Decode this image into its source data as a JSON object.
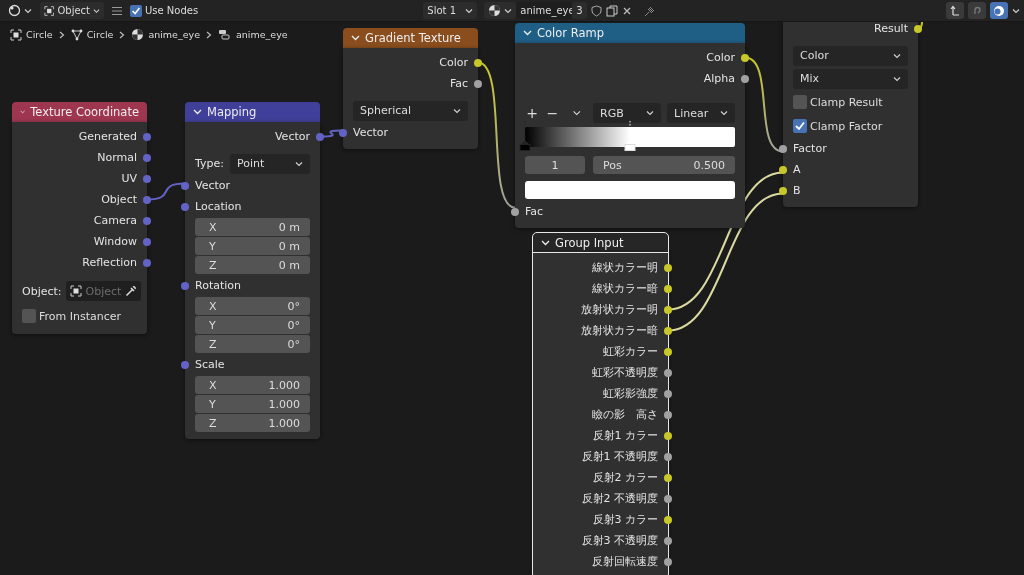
{
  "header": {
    "mode": "Object",
    "use_nodes": {
      "label": "Use Nodes",
      "checked": true
    },
    "slot": "Slot 1",
    "material": "anime_eye",
    "users": "3",
    "tools": [
      {
        "kind": "parent",
        "on": false
      },
      {
        "kind": "snap",
        "on": false
      },
      {
        "kind": "overlay",
        "on": true
      }
    ]
  },
  "breadcrumbs": [
    {
      "kind": "object",
      "label": "Circle"
    },
    {
      "kind": "mesh",
      "label": "Circle"
    },
    {
      "kind": "material",
      "label": "anime_eye"
    },
    {
      "kind": "nodetree",
      "label": "anime_eye"
    }
  ],
  "nodes": [
    {
      "title": "Gradient Texture",
      "color": "#8a4e1e",
      "selected": false,
      "rows": [
        {
          "kind": "output",
          "label": "Color",
          "color": "#c7c729"
        },
        {
          "kind": "output",
          "label": "Fac",
          "color": "#a1a1a1"
        },
        {
          "kind": "dropdown",
          "value": "Spherical"
        },
        {
          "kind": "input",
          "label": "Vector",
          "color": "#6363c7"
        }
      ]
    },
    {
      "title": "Color Ramp",
      "color": "#1f5f86",
      "selected": false,
      "rows": [
        {
          "kind": "output",
          "label": "Color",
          "color": "#c7c729"
        },
        {
          "kind": "output",
          "label": "Alpha",
          "color": "#a1a1a1"
        },
        {
          "kind": "ramp",
          "add": "+",
          "remove": "−",
          "color_mode": "RGB",
          "interpolation": "Linear",
          "stops": [
            {
              "color": "#000000",
              "level": 0,
              "selected": false
            },
            {
              "color": "#ffffff",
              "level": 0.5,
              "selected": true
            }
          ],
          "index": "1",
          "pos_label": "Pos",
          "pos_value": "0.500"
        },
        {
          "kind": "input",
          "label": "Fac",
          "color": "#a1a1a1"
        }
      ]
    },
    {
      "selected": false,
      "rows": [
        {
          "kind": "output",
          "label": "Result",
          "color": "#c7c729"
        },
        {
          "kind": "dropdown",
          "value": "Color"
        },
        {
          "kind": "dropdown",
          "value": "Mix"
        },
        {
          "kind": "checkbox",
          "label": "Clamp Result",
          "checked": false
        },
        {
          "kind": "checkbox",
          "label": "Clamp Factor",
          "checked": true
        },
        {
          "kind": "input",
          "label": "Factor",
          "color": "#a1a1a1"
        },
        {
          "kind": "input",
          "label": "A",
          "color": "#c7c729"
        },
        {
          "kind": "input",
          "label": "B",
          "color": "#c7c729"
        }
      ]
    },
    {
      "title": "Texture Coordinate",
      "color": "#9e3650",
      "selected": false,
      "rows": [
        {
          "kind": "output",
          "label": "Generated",
          "color": "#6363c7"
        },
        {
          "kind": "output",
          "label": "Normal",
          "color": "#6363c7"
        },
        {
          "kind": "output",
          "label": "UV",
          "color": "#6363c7"
        },
        {
          "kind": "output",
          "label": "Object",
          "color": "#6363c7"
        },
        {
          "kind": "output",
          "label": "Camera",
          "color": "#6363c7"
        },
        {
          "kind": "output",
          "label": "Window",
          "color": "#6363c7"
        },
        {
          "kind": "output",
          "label": "Reflection",
          "color": "#6363c7"
        },
        {
          "kind": "object-field",
          "label": "Object:",
          "placeholder": "Object"
        },
        {
          "kind": "checkbox",
          "label": "From Instancer",
          "checked": false
        }
      ]
    },
    {
      "title": "Mapping",
      "color": "#40409a",
      "selected": false,
      "rows": [
        {
          "kind": "output",
          "label": "Vector",
          "color": "#6363c7"
        },
        {
          "kind": "labeled-dropdown",
          "label": "Type:",
          "value": "Point"
        },
        {
          "kind": "input",
          "label": "Vector",
          "color": "#6363c7"
        },
        {
          "kind": "input",
          "label": "Location",
          "color": "#6363c7"
        },
        {
          "kind": "vector-fields",
          "items": [
            {
              "axis": "X",
              "value": "0 m"
            },
            {
              "axis": "Y",
              "value": "0 m"
            },
            {
              "axis": "Z",
              "value": "0 m"
            }
          ]
        },
        {
          "kind": "input",
          "label": "Rotation",
          "color": "#6363c7"
        },
        {
          "kind": "vector-fields",
          "items": [
            {
              "axis": "X",
              "value": "0°"
            },
            {
              "axis": "Y",
              "value": "0°"
            },
            {
              "axis": "Z",
              "value": "0°"
            }
          ]
        },
        {
          "kind": "input",
          "label": "Scale",
          "color": "#6363c7"
        },
        {
          "kind": "vector-fields",
          "items": [
            {
              "axis": "X",
              "value": "1.000"
            },
            {
              "axis": "Y",
              "value": "1.000"
            },
            {
              "axis": "Z",
              "value": "1.000"
            }
          ]
        }
      ]
    },
    {
      "title": "Group Input",
      "color": "#262626",
      "selected": true,
      "rows": [
        {
          "kind": "output",
          "label": "線状カラー明",
          "color": "#c7c729"
        },
        {
          "kind": "output",
          "label": "線状カラー暗",
          "color": "#c7c729"
        },
        {
          "kind": "output",
          "label": "放射状カラー明",
          "color": "#c7c729"
        },
        {
          "kind": "output",
          "label": "放射状カラー暗",
          "color": "#c7c729"
        },
        {
          "kind": "output",
          "label": "虹彩カラー",
          "color": "#c7c729"
        },
        {
          "kind": "output",
          "label": "虹彩不透明度",
          "color": "#a1a1a1"
        },
        {
          "kind": "output",
          "label": "虹彩影強度",
          "color": "#a1a1a1"
        },
        {
          "kind": "output",
          "label": "瞼の影　高さ",
          "color": "#a1a1a1"
        },
        {
          "kind": "output",
          "label": "反射1 カラー",
          "color": "#c7c729"
        },
        {
          "kind": "output",
          "label": "反射1 不透明度",
          "color": "#a1a1a1"
        },
        {
          "kind": "output",
          "label": "反射2 カラー",
          "color": "#c7c729"
        },
        {
          "kind": "output",
          "label": "反射2 不透明度",
          "color": "#a1a1a1"
        },
        {
          "kind": "output",
          "label": "反射3 カラー",
          "color": "#c7c729"
        },
        {
          "kind": "output",
          "label": "反射3 不透明度",
          "color": "#a1a1a1"
        },
        {
          "kind": "output",
          "label": "反射回転速度",
          "color": "#a1a1a1"
        }
      ]
    }
  ]
}
